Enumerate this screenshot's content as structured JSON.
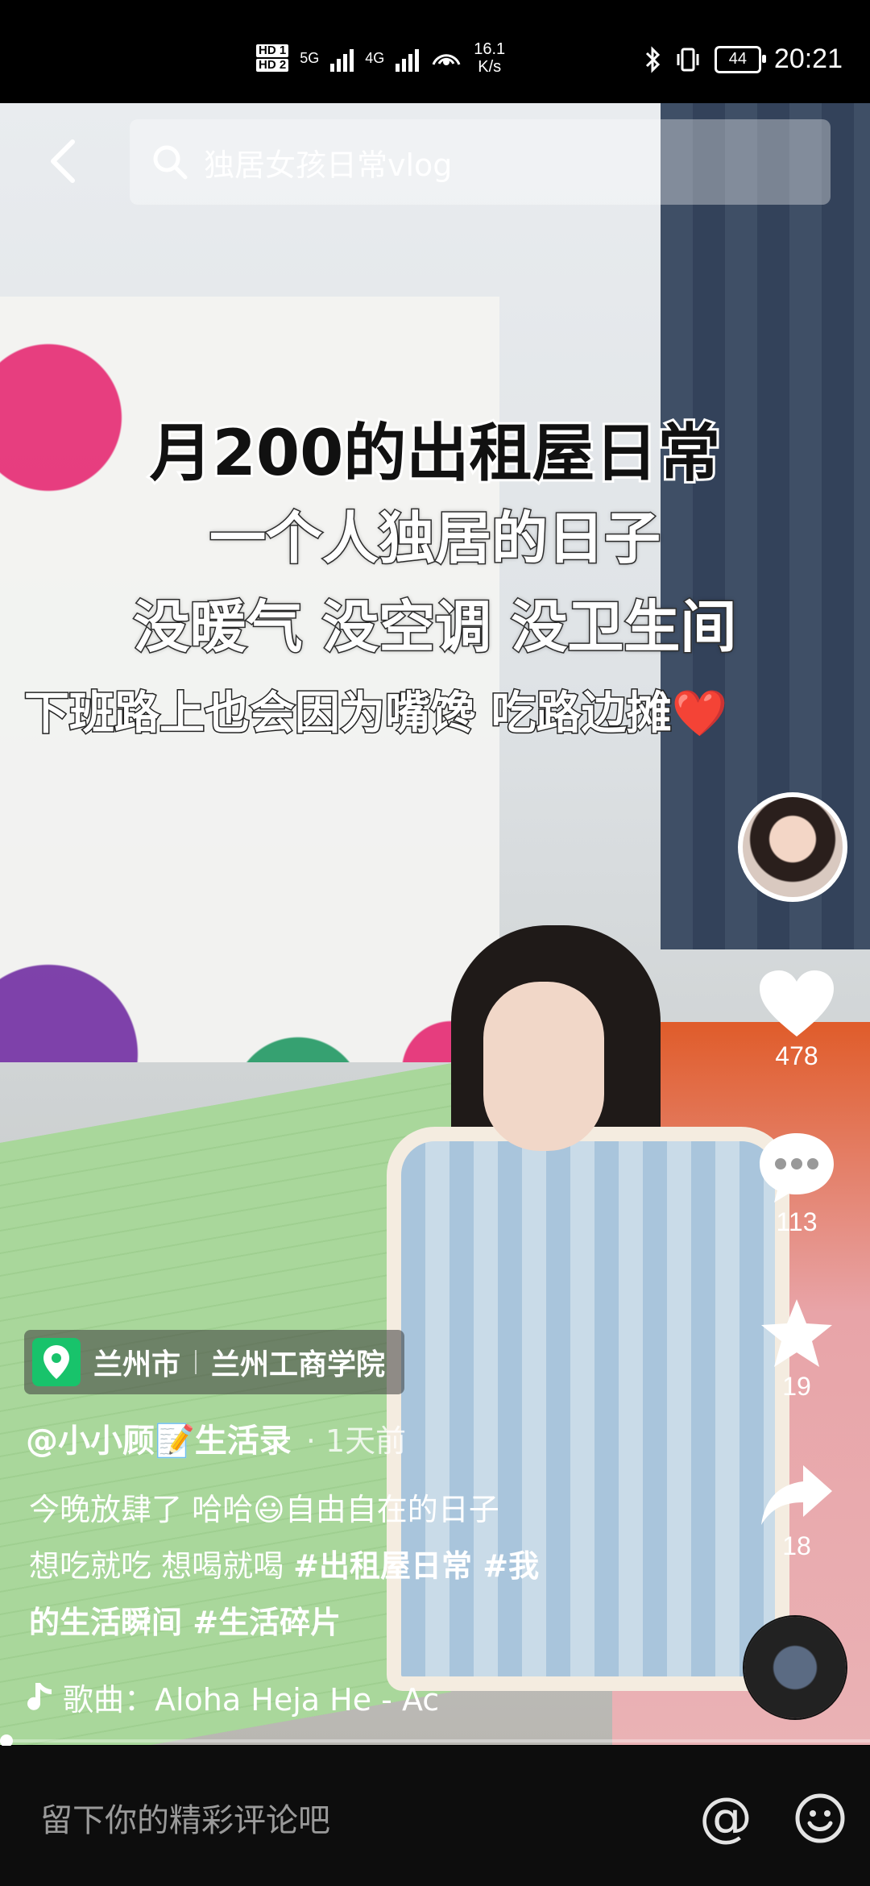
{
  "status_bar": {
    "hd1": "HD 1",
    "hd2": "HD 2",
    "net1": "5G",
    "net2": "4G",
    "speed_value": "16.1",
    "speed_unit": "K/s",
    "battery": "44",
    "time": "20:21"
  },
  "search": {
    "text": "独居女孩日常vlog"
  },
  "captions": {
    "line1": "月200的出租屋日常",
    "line2": "一个人独居的日子",
    "line3": "没暖气 没空调 没卫生间",
    "line4": "下班路上也会因为嘴馋 吃路边摊",
    "line4_emoji": "❤️"
  },
  "actions": {
    "likes": "478",
    "comments": "113",
    "favorites": "19",
    "shares": "18"
  },
  "location": {
    "city": "兰州市",
    "place": "兰州工商学院"
  },
  "author": {
    "name": "@小小顾📝生活录",
    "time": "· 1天前"
  },
  "description": {
    "text1": "今晚放肆了 哈哈😃自由自在的日子",
    "text2": "想吃就吃 想喝就喝 ",
    "tags1": "#出租屋日常 #我",
    "tags2": "的生活瞬间 #生活碎片"
  },
  "song": {
    "label": "歌曲：Aloha Heja He - Ac"
  },
  "comment_bar": {
    "placeholder": "留下你的精彩评论吧",
    "at_symbol": "@"
  },
  "colors": {
    "location_green": "#18c36b",
    "heart_red": "#e6262e"
  }
}
